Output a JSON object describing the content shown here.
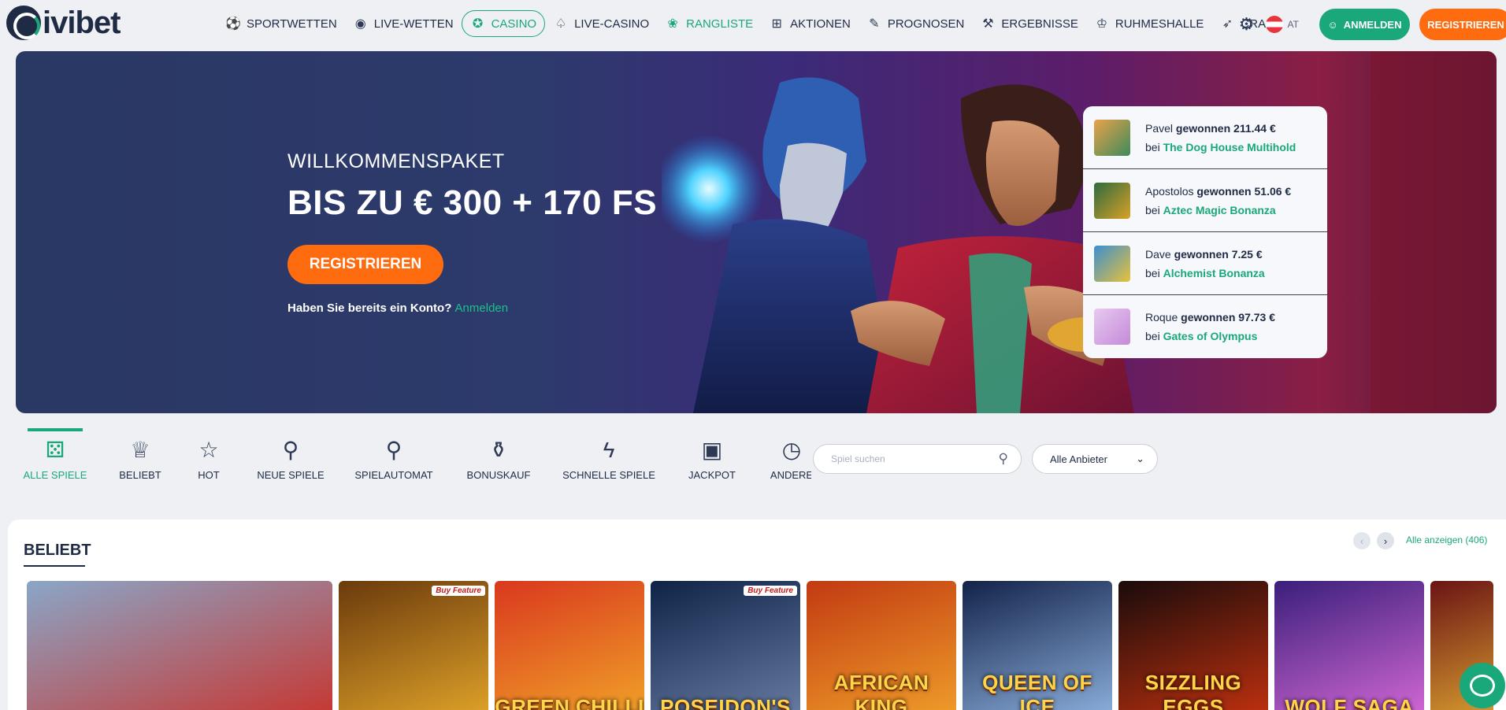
{
  "brand": {
    "name": "ivibet"
  },
  "nav": [
    {
      "label": "SPORTWETTEN",
      "icon": "⚽",
      "icon_name": "soccer-ball-icon",
      "state": "normal"
    },
    {
      "label": "LIVE-WETTEN",
      "icon": "◉",
      "icon_name": "stopwatch-icon",
      "state": "normal"
    },
    {
      "label": "CASINO",
      "icon": "✪",
      "icon_name": "casino-chip-icon",
      "state": "active"
    },
    {
      "label": "LIVE-CASINO",
      "icon": "♤",
      "icon_name": "cards-icon",
      "state": "normal"
    },
    {
      "label": "RANGLISTE",
      "icon": "❀",
      "icon_name": "laurel-icon",
      "state": "green"
    },
    {
      "label": "AKTIONEN",
      "icon": "⊞",
      "icon_name": "gift-icon",
      "state": "normal"
    },
    {
      "label": "PROGNOSEN",
      "icon": "✎",
      "icon_name": "prediction-icon",
      "state": "normal"
    },
    {
      "label": "ERGEBNISSE",
      "icon": "⚒",
      "icon_name": "results-icon",
      "state": "normal"
    },
    {
      "label": "RUHMESHALLE",
      "icon": "♔",
      "icon_name": "hall-of-fame-icon",
      "state": "normal"
    },
    {
      "label": "CRASH",
      "icon": "➶",
      "icon_name": "rocket-icon",
      "state": "normal"
    }
  ],
  "header_right": {
    "lang": "AT",
    "login_label": "ANMELDEN",
    "register_label": "REGISTRIEREN"
  },
  "hero": {
    "subtitle": "WILLKOMMENSPAKET",
    "title": "BIS ZU € 300 + 170 FS",
    "button": "REGISTRIEREN",
    "account_text": "Haben Sie bereits ein Konto?",
    "account_link": "Anmelden"
  },
  "winners": [
    {
      "name": "Pavel",
      "won_label": "gewonnen",
      "amount": "211.44 €",
      "at": "bei",
      "game": "The Dog House Multihold",
      "thumb": [
        "#e9a24a",
        "#3d8b5a"
      ]
    },
    {
      "name": "Apostolos",
      "won_label": "gewonnen",
      "amount": "51.06 €",
      "at": "bei",
      "game": "Aztec Magic Bonanza",
      "thumb": [
        "#2f6b3e",
        "#d9a126"
      ]
    },
    {
      "name": "Dave",
      "won_label": "gewonnen",
      "amount": "7.25 €",
      "at": "bei",
      "game": "Alchemist Bonanza",
      "thumb": [
        "#3b8fd1",
        "#e8c13a"
      ]
    },
    {
      "name": "Roque",
      "won_label": "gewonnen",
      "amount": "97.73 €",
      "at": "bei",
      "game": "Gates of Olympus",
      "thumb": [
        "#e7c9f0",
        "#c58ad8"
      ]
    }
  ],
  "categories": [
    {
      "label": "ALLE SPIELE",
      "icon": "⚄",
      "icon_name": "dice-icon",
      "active": true
    },
    {
      "label": "BELIEBT",
      "icon": "♕",
      "icon_name": "crown-icon",
      "active": false
    },
    {
      "label": "HOT",
      "icon": "☆",
      "icon_name": "star-icon",
      "active": false
    },
    {
      "label": "NEUE SPIELE",
      "icon": "⚲",
      "icon_name": "cherries-icon",
      "active": false
    },
    {
      "label": "SPIELAUTOMAT",
      "icon": "⚲",
      "icon_name": "cherry-icon",
      "active": false
    },
    {
      "label": "BONUSKAUF",
      "icon": "⚱",
      "icon_name": "money-bag-icon",
      "active": false
    },
    {
      "label": "SCHNELLE SPIELE",
      "icon": "ϟ",
      "icon_name": "lightning-icon",
      "active": false
    },
    {
      "label": "JACKPOT",
      "icon": "▣",
      "icon_name": "jackpot-machine-icon",
      "active": false
    },
    {
      "label": "ANDERE",
      "icon": "◷",
      "icon_name": "timer-icon",
      "active": false
    }
  ],
  "search": {
    "placeholder": "Spiel suchen"
  },
  "provider": {
    "selected": "Alle Anbieter"
  },
  "popular": {
    "title": "BELIEBT",
    "see_all": "Alle anzeigen (406)",
    "games": [
      {
        "name": "",
        "badge": "",
        "colors": [
          "#8aa6c8",
          "#c8342e"
        ]
      },
      {
        "name": "",
        "badge": "Buy Feature",
        "colors": [
          "#6a3a0c",
          "#e3a52a"
        ]
      },
      {
        "name": "GREEN CHILLI",
        "badge": "",
        "colors": [
          "#d9381e",
          "#f2a529"
        ]
      },
      {
        "name": "POSEIDON'S",
        "badge": "Buy Feature",
        "colors": [
          "#0e2346",
          "#6b7fa6"
        ]
      },
      {
        "name": "AFRICAN KING",
        "badge": "",
        "colors": [
          "#c23a12",
          "#f0a02a"
        ]
      },
      {
        "name": "QUEEN OF ICE",
        "badge": "",
        "colors": [
          "#13234a",
          "#8fb3e0"
        ]
      },
      {
        "name": "SIZZLING EGGS",
        "badge": "",
        "colors": [
          "#1a0b0b",
          "#c4320f"
        ]
      },
      {
        "name": "WOLF SAGA",
        "badge": "",
        "colors": [
          "#3a1f7a",
          "#d76ad8"
        ]
      },
      {
        "name": "",
        "badge": "",
        "colors": [
          "#6b1414",
          "#d9a030"
        ]
      }
    ]
  }
}
